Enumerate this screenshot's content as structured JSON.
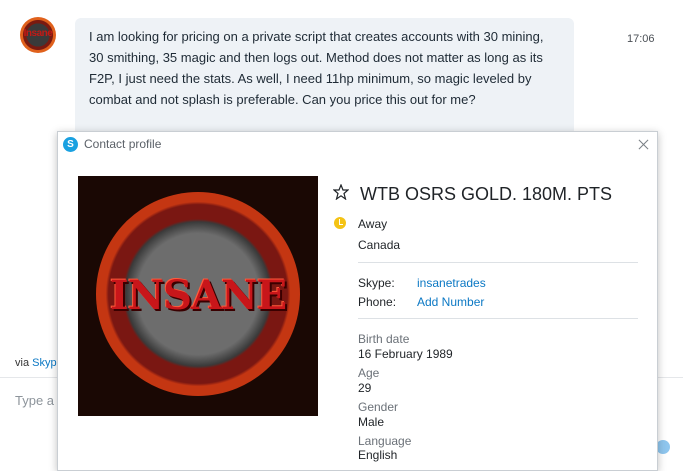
{
  "conversation": {
    "avatar_text": "Insane",
    "message": "I am looking for pricing on a private script that creates accounts with 30 mining, 30 smithing, 35 magic and then logs out. Method does not matter as long as its F2P, I just need the stats. As well, I need 11hp minimum, so magic leveled by combat and not splash is preferable. Can you price this out for me?",
    "time": "17:06",
    "via_prefix": "via ",
    "via_link": "Skype",
    "input_placeholder": "Type a"
  },
  "profile_dialog": {
    "title": "Contact profile",
    "picture_text": "INSANE",
    "display_name": "WTB OSRS GOLD. 180M. PTS",
    "status": "Away",
    "location": "Canada",
    "skype_label": "Skype:",
    "skype_value": "insanetrades",
    "phone_label": "Phone:",
    "phone_value": "Add Number",
    "birth_date_label": "Birth date",
    "birth_date_value": "16 February 1989",
    "age_label": "Age",
    "age_value": "29",
    "gender_label": "Gender",
    "gender_value": "Male",
    "language_label": "Language",
    "language_value": "English"
  },
  "colors": {
    "accent": "#0b78c4",
    "bubble": "#eef2f6",
    "away": "#f4c315",
    "skype": "#1aa1e1"
  },
  "icons": {
    "skype": "skype-icon",
    "close": "close-icon",
    "favorite": "star-icon",
    "status": "away-clock-icon"
  }
}
